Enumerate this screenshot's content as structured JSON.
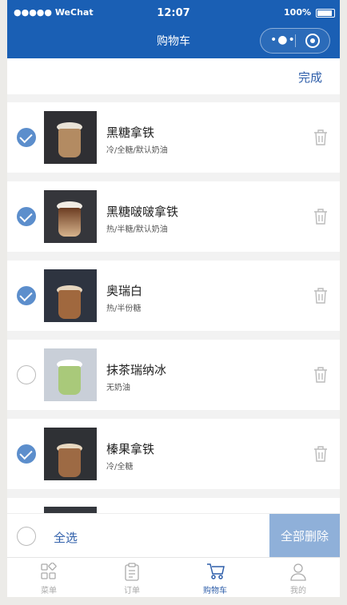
{
  "status": {
    "carrier": "●●●●● WeChat",
    "time": "12:07",
    "battery": "100%"
  },
  "nav": {
    "title": "购物车",
    "capsule_dots": "•●•"
  },
  "done_label": "完成",
  "items": [
    {
      "name": "黑糖拿铁",
      "spec": "冷/全糖/默认奶油",
      "checked": true
    },
    {
      "name": "黑糖啵啵拿铁",
      "spec": "热/半糖/默认奶油",
      "checked": true
    },
    {
      "name": "奥瑞白",
      "spec": "热/半份糖",
      "checked": true
    },
    {
      "name": "抹茶瑞纳冰",
      "spec": "无奶油",
      "checked": false
    },
    {
      "name": "榛果拿铁",
      "spec": "冷/全糖",
      "checked": true
    }
  ],
  "bottom": {
    "select_all": "全选",
    "delete_all": "全部删除"
  },
  "tabs": [
    {
      "label": "菜单",
      "icon": "menu-grid-icon",
      "active": false
    },
    {
      "label": "订单",
      "icon": "order-clipboard-icon",
      "active": false
    },
    {
      "label": "购物车",
      "icon": "cart-icon",
      "active": true
    },
    {
      "label": "我的",
      "icon": "user-icon",
      "active": false
    }
  ],
  "colors": {
    "accent": "#1a5fb4",
    "link": "#2f5faa",
    "check": "#5c8ecc",
    "delete_bg": "#8fb0d9"
  }
}
